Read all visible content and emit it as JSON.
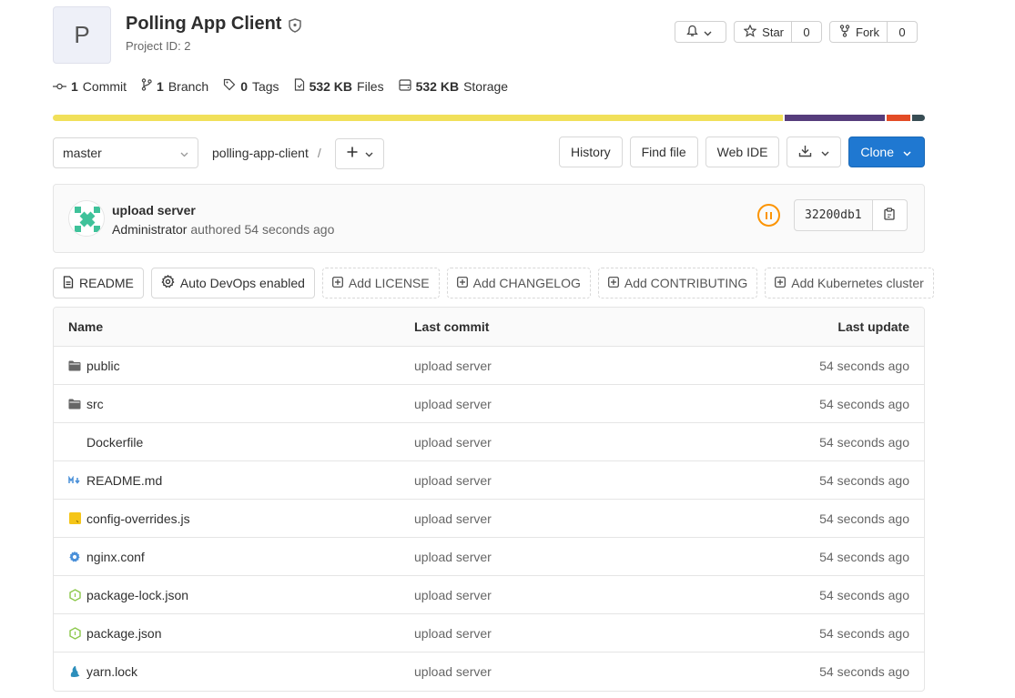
{
  "project": {
    "avatar_letter": "P",
    "name": "Polling App Client",
    "id_text": "Project ID: 2"
  },
  "actions": {
    "star_label": "Star",
    "star_count": "0",
    "fork_label": "Fork",
    "fork_count": "0"
  },
  "stats": {
    "commits_count": "1",
    "commits_label": "Commit",
    "branches_count": "1",
    "branches_label": "Branch",
    "tags_count": "0",
    "tags_label": "Tags",
    "files_size": "532 KB",
    "files_label": "Files",
    "storage_size": "532 KB",
    "storage_label": "Storage"
  },
  "languages": [
    {
      "color": "#f1e05a",
      "share": 0.842
    },
    {
      "color": "#563d7c",
      "share": 0.116
    },
    {
      "color": "#e34c26",
      "share": 0.027
    },
    {
      "color": "#384d54",
      "share": 0.015
    }
  ],
  "nav": {
    "branch": "master",
    "path": "polling-app-client",
    "separator": "/",
    "history_label": "History",
    "find_file_label": "Find file",
    "web_ide_label": "Web IDE",
    "clone_label": "Clone"
  },
  "last_commit": {
    "title": "upload server",
    "author": "Administrator",
    "authored_text": "authored 54 seconds ago",
    "sha": "32200db1",
    "pipeline_status_color": "#fc9403"
  },
  "quick_links": {
    "readme": "README",
    "autodevops": "Auto DevOps enabled",
    "add_license": "Add LICENSE",
    "add_changelog": "Add CHANGELOG",
    "add_contributing": "Add CONTRIBUTING",
    "add_k8s": "Add Kubernetes cluster"
  },
  "tree": {
    "headers": {
      "name": "Name",
      "last_commit": "Last commit",
      "last_update": "Last update"
    },
    "rows": [
      {
        "name": "public",
        "icon": "folder-icon",
        "commit": "upload server",
        "updated": "54 seconds ago"
      },
      {
        "name": "src",
        "icon": "folder-icon",
        "commit": "upload server",
        "updated": "54 seconds ago"
      },
      {
        "name": "Dockerfile",
        "icon": "none",
        "commit": "upload server",
        "updated": "54 seconds ago"
      },
      {
        "name": "README.md",
        "icon": "markdown-icon",
        "commit": "upload server",
        "updated": "54 seconds ago"
      },
      {
        "name": "config-overrides.js",
        "icon": "javascript-icon",
        "commit": "upload server",
        "updated": "54 seconds ago"
      },
      {
        "name": "nginx.conf",
        "icon": "gear-icon",
        "commit": "upload server",
        "updated": "54 seconds ago"
      },
      {
        "name": "package-lock.json",
        "icon": "nodejs-icon",
        "commit": "upload server",
        "updated": "54 seconds ago"
      },
      {
        "name": "package.json",
        "icon": "nodejs-icon",
        "commit": "upload server",
        "updated": "54 seconds ago"
      },
      {
        "name": "yarn.lock",
        "icon": "yarn-icon",
        "commit": "upload server",
        "updated": "54 seconds ago"
      }
    ]
  }
}
